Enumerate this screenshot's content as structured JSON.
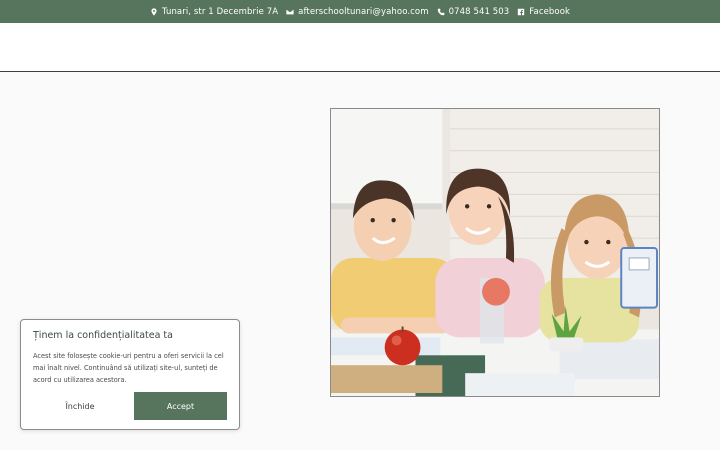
{
  "topbar": {
    "address": "Tunari, str 1 Decembrie 7A",
    "email": "afterschooltunari@yahoo.com",
    "phone": "0748 541 503",
    "facebook": "Facebook",
    "icons": [
      "map-marker-icon",
      "envelope-icon",
      "phone-icon",
      "facebook-icon"
    ],
    "background_color": "#57745d"
  },
  "hero": {
    "image_description": "Three smiling children at a school desk with an apple and a small plant"
  },
  "cookie_notice": {
    "title": "Ținem la confidențialitatea ta",
    "text": "Acest site folosește cookie-uri pentru a oferi servicii la cel mai înalt nivel. Continuând să utilizați site-ul, sunteți de acord cu utilizarea acestora.",
    "close_label": "Închide",
    "accept_label": "Accept",
    "accent_color": "#57745d"
  }
}
